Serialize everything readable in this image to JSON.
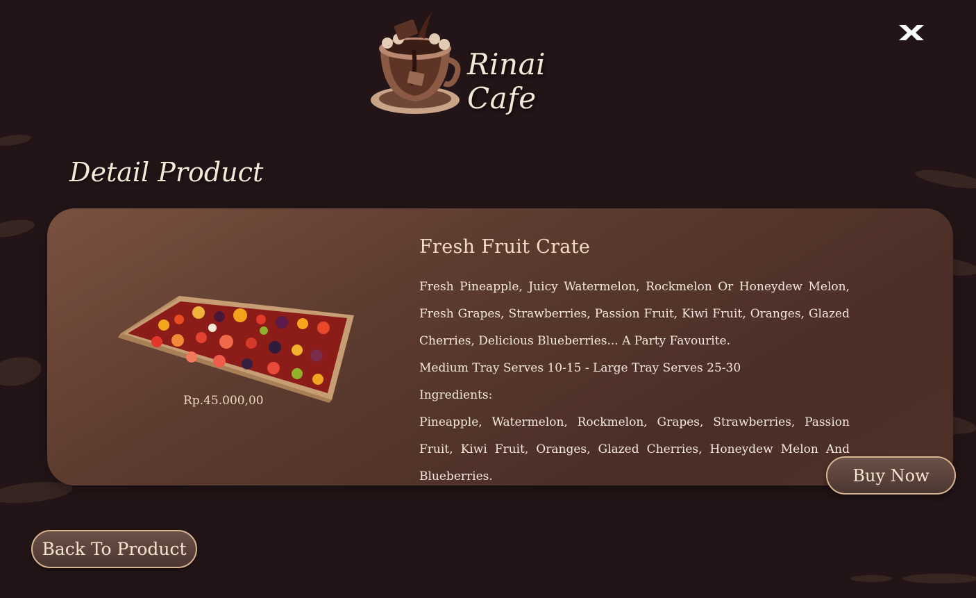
{
  "brand": {
    "name": "Rinai Cafe"
  },
  "page": {
    "title": "Detail Product"
  },
  "product": {
    "name": "Fresh Fruit Crate",
    "price": "Rp.45.000,00",
    "description": "Fresh Pineapple, Juicy Watermelon, Rockmelon Or Honeydew Melon, Fresh Grapes, Strawberries, Passion Fruit, Kiwi Fruit, Oranges, Glazed Cherries, Delicious Blueberries... A Party Favourite.",
    "serving": "Medium Tray Serves 10-15 - Large Tray Serves 25-30",
    "ingredients_label": "Ingredients:",
    "ingredients": "Pineapple, Watermelon, Rockmelon, Grapes, Strawberries, Passion Fruit, Kiwi Fruit, Oranges, Glazed Cherries, Honeydew Melon And Blueberries."
  },
  "actions": {
    "buy_label": "Buy Now",
    "back_label": "Back To Product"
  },
  "icons": {
    "close": "close-icon",
    "logo": "coffee-cup-logo"
  },
  "colors": {
    "background": "#231517",
    "card": "#5d3c30",
    "accent": "#d9b491"
  }
}
